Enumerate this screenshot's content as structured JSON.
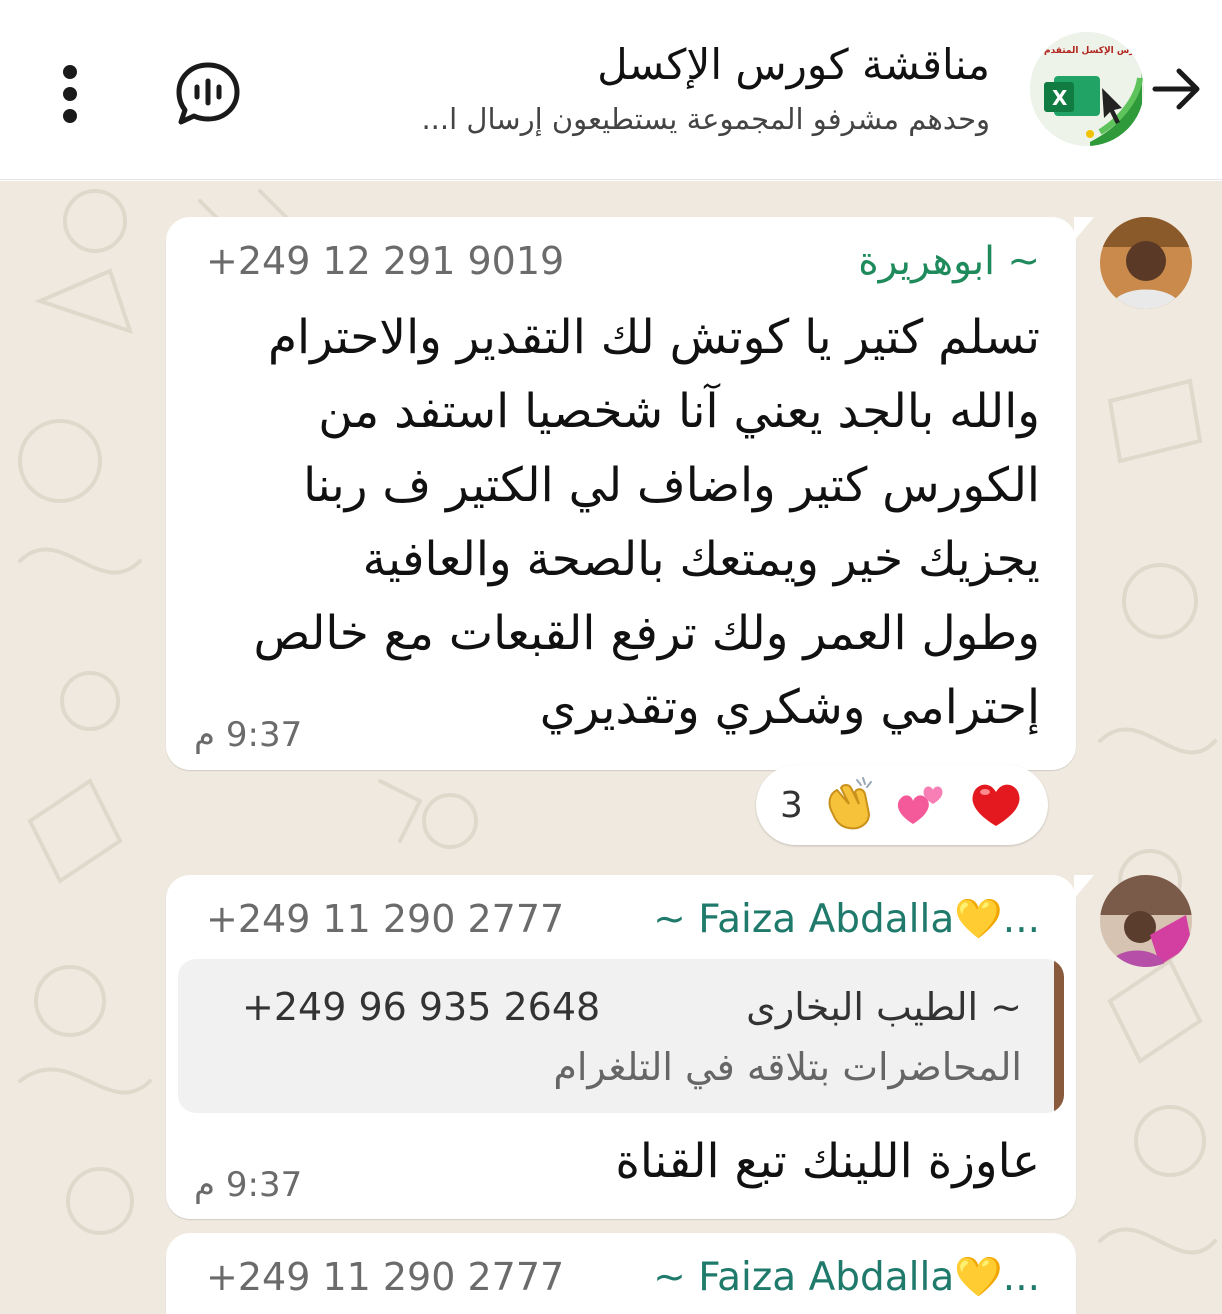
{
  "header": {
    "title": "مناقشة كورس الإكسل",
    "subtitle": "وحدهم مشرفو المجموعة يستطيعون إرسال ا...",
    "avatar_caption": "ـرس الإكسل المتقدم",
    "icons": {
      "back": "arrow-right-icon",
      "voice_chat": "voice-chat-icon",
      "more": "more-vertical-icon"
    }
  },
  "messages": [
    {
      "sender": "~ ابوهريرة",
      "sender_color": "#1f8a5b",
      "phone": "+249 12 291 9019",
      "lines": [
        "تسلم كتير يا كوتش لك التقدير والاحترام",
        "والله بالجد يعني آنا شخصيا استفد من",
        "الكورس كتير واضاف لي الكتير ف ربنا",
        "يجزيك خير ويمتعك بالصحة والعافية",
        "وطول العمر ولك ترفع القبعات مع خالص",
        "إحترامي وشكري وتقديري"
      ],
      "time": "9:37 م",
      "reactions": {
        "emojis": [
          "❤️",
          "💕",
          "👏"
        ],
        "count": "3"
      }
    },
    {
      "sender": "~ Faiza Abdalla💛...",
      "sender_color": "#1f7a6b",
      "phone": "+249 11 290 2777",
      "quote": {
        "name": "~ الطيب البخارى",
        "phone": "+249 96 935 2648",
        "text": "المحاضرات بتلاقه في التلغرام"
      },
      "text": "عاوزة اللينك تبع القناة",
      "time": "9:37 م"
    },
    {
      "sender": "~ Faiza Abdalla💛...",
      "sender_color": "#1f7a6b",
      "phone": "+249 11 290 2777"
    }
  ],
  "colors": {
    "wallpaper": "#efe9df",
    "bubble": "#ffffff",
    "quote_bar": "#8a5a3c"
  }
}
